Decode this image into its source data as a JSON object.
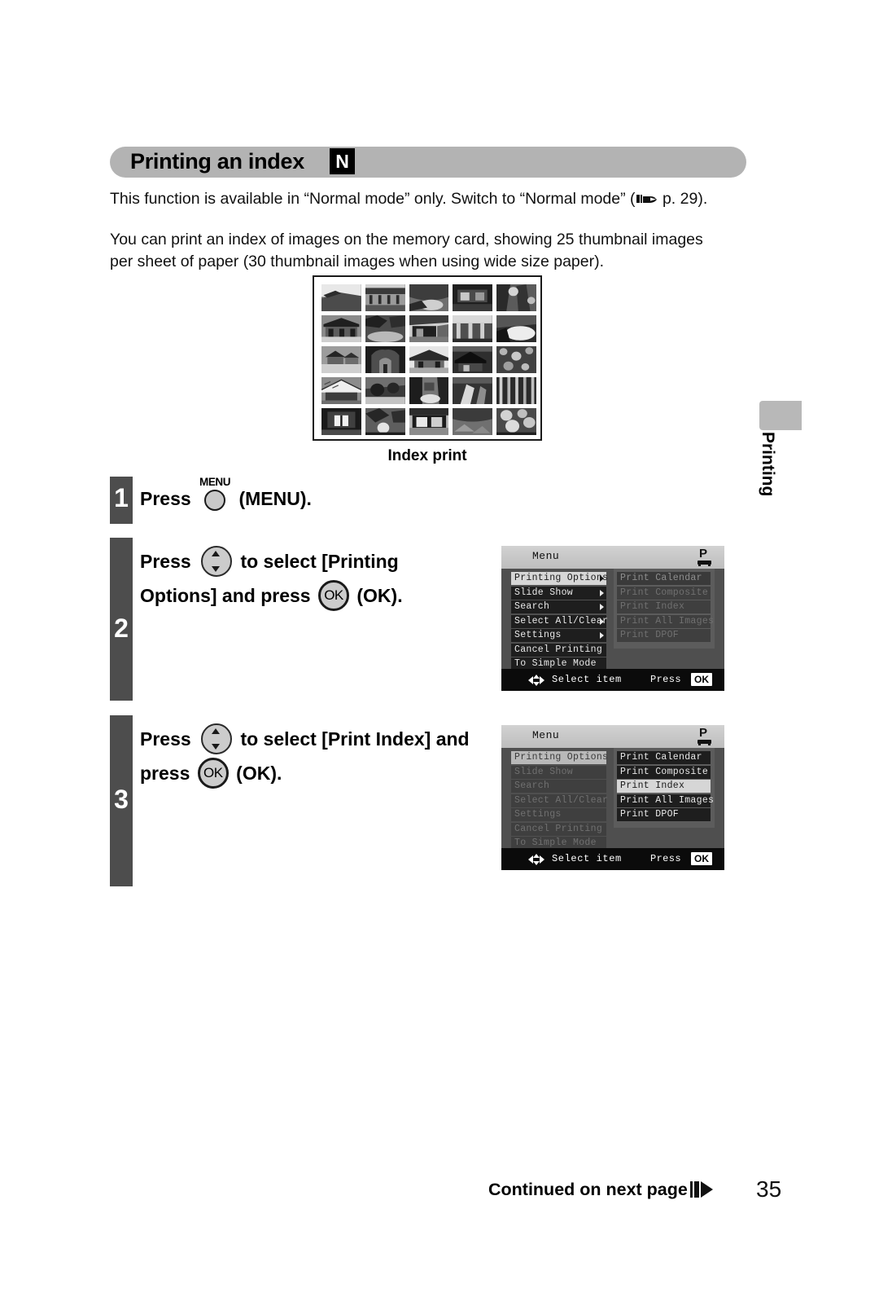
{
  "page": {
    "title": "Printing an index",
    "title_badge": "N",
    "page_number": "35",
    "side_tab_label": "Printing",
    "footer_continued": "Continued on next page",
    "footer_arrow_icon": "play-arrow-icon"
  },
  "intro": {
    "normal_mode_before": "This function is available in “Normal mode” only. Switch to “Normal mode” (",
    "reference_icon": "pointing-hand-icon",
    "reference_page": " p. 29).",
    "description": "You can print an index of images on the memory card, showing 25 thumbnail images per sheet of paper (30 thumbnail images when using wide size paper)."
  },
  "figure": {
    "caption": "Index print",
    "thumbnail_count": 25,
    "grid_columns": 5,
    "grid_rows": 5
  },
  "steps": [
    {
      "number": "1",
      "text_before": "Press ",
      "button_caption": "MENU",
      "button_icon": "menu-button-icon",
      "text_after": " (MENU)."
    },
    {
      "number": "2",
      "line1_before": "Press ",
      "line1_button_icon": "up-down-button-icon",
      "line1_after": " to select [Printing",
      "line2_before": "Options] and press ",
      "line2_button_label": "OK",
      "line2_button_icon": "ok-button-icon",
      "line2_after": " (OK)."
    },
    {
      "number": "3",
      "line1_before": "Press ",
      "line1_button_icon": "up-down-button-icon",
      "line1_after": " to select [Print Index] and",
      "line2_before": "press ",
      "line2_button_label": "OK",
      "line2_button_icon": "ok-button-icon",
      "line2_after": " (OK)."
    }
  ],
  "lcd_screens": [
    {
      "id": "menu-step2",
      "header_title": "Menu",
      "printer_icon": "printer-icon",
      "left_items": [
        {
          "label": "Printing Options",
          "state": "selected",
          "has_arrow": true
        },
        {
          "label": "Slide Show",
          "state": "dark",
          "has_arrow": true
        },
        {
          "label": "Search",
          "state": "dark",
          "has_arrow": true
        },
        {
          "label": "Select All/Clear",
          "state": "dark",
          "has_arrow": true
        },
        {
          "label": "Settings",
          "state": "dark",
          "has_arrow": true
        },
        {
          "label": "Cancel Printing",
          "state": "dark",
          "has_arrow": false
        },
        {
          "label": "To Simple Mode",
          "state": "dark",
          "has_arrow": false
        }
      ],
      "right_items": [
        {
          "label": "Print Calendar",
          "state": "dim",
          "has_arrow": false
        },
        {
          "label": "Print Composite",
          "state": "dimmer",
          "has_arrow": false
        },
        {
          "label": "Print Index",
          "state": "dimmer",
          "has_arrow": false
        },
        {
          "label": "Print All Images",
          "state": "dimmer",
          "has_arrow": false
        },
        {
          "label": "Print DPOF",
          "state": "dimmer",
          "has_arrow": false
        }
      ],
      "footer": {
        "nav_icon": "dpad-arrows-icon",
        "select_item": "Select item",
        "press_label": "Press",
        "ok_chip": "OK"
      }
    },
    {
      "id": "menu-step3",
      "header_title": "Menu",
      "printer_icon": "printer-icon",
      "left_items": [
        {
          "label": "Printing Options",
          "state": "dim-selected",
          "has_arrow": false
        },
        {
          "label": "Slide Show",
          "state": "dimmer",
          "has_arrow": false
        },
        {
          "label": "Search",
          "state": "dimmer",
          "has_arrow": false
        },
        {
          "label": "Select All/Clear",
          "state": "dimmer",
          "has_arrow": false
        },
        {
          "label": "Settings",
          "state": "dimmer",
          "has_arrow": false
        },
        {
          "label": "Cancel Printing",
          "state": "dimmer",
          "has_arrow": false
        },
        {
          "label": "To Simple Mode",
          "state": "dimmer",
          "has_arrow": false
        }
      ],
      "right_items": [
        {
          "label": "Print Calendar",
          "state": "dark",
          "has_arrow": false
        },
        {
          "label": "Print Composite",
          "state": "dark",
          "has_arrow": false
        },
        {
          "label": "Print Index",
          "state": "selected",
          "has_arrow": false
        },
        {
          "label": "Print All Images",
          "state": "dark",
          "has_arrow": false
        },
        {
          "label": "Print DPOF",
          "state": "dark",
          "has_arrow": false
        }
      ],
      "footer": {
        "nav_icon": "dpad-arrows-icon",
        "select_item": "Select item",
        "press_label": "Press",
        "ok_chip": "OK"
      }
    }
  ],
  "colors": {
    "title_bar": "#b3b3b3",
    "badge": "#000000",
    "step_bar": "#4d4d4d",
    "lcd_bg": "#4f4f4f",
    "lcd_selected": "#d6d6d6",
    "lcd_footer": "#0b0b0b"
  }
}
